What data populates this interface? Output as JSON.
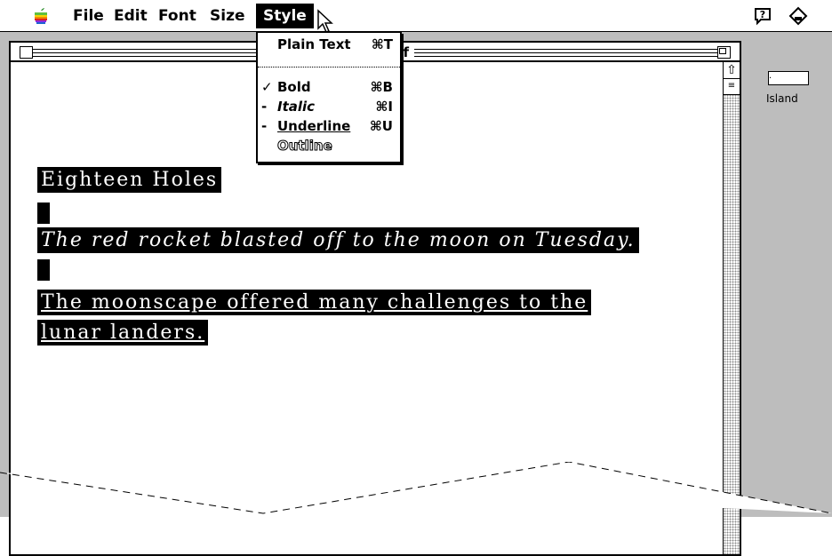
{
  "menubar": {
    "items": [
      {
        "label": "File"
      },
      {
        "label": "Edit"
      },
      {
        "label": "Font"
      },
      {
        "label": "Size"
      },
      {
        "label": "Style"
      }
    ],
    "icons": [
      "apple-icon",
      "help-icon",
      "app-icon"
    ]
  },
  "window": {
    "title_fragment": "olf"
  },
  "dropdown": {
    "items": [
      {
        "label": "Plain Text",
        "shortcut": "⌘T",
        "mark": ""
      },
      {
        "label": "Bold",
        "shortcut": "⌘B",
        "mark": "✓"
      },
      {
        "label": "Italic",
        "shortcut": "⌘I",
        "mark": "-"
      },
      {
        "label": "Underline",
        "shortcut": "⌘U",
        "mark": "-"
      },
      {
        "label": "Outline",
        "shortcut": "",
        "mark": ""
      }
    ]
  },
  "document": {
    "line1": "Eighteen Holes",
    "line2": "The red rocket blasted off to the moon on Tuesday.",
    "line3": "The moonscape offered many challenges to the",
    "line4": "lunar landers."
  },
  "side_panel": {
    "label": "Island",
    "box_text": "."
  },
  "colors": {
    "desktop": "#bdbdbd",
    "selection": "#000000"
  }
}
